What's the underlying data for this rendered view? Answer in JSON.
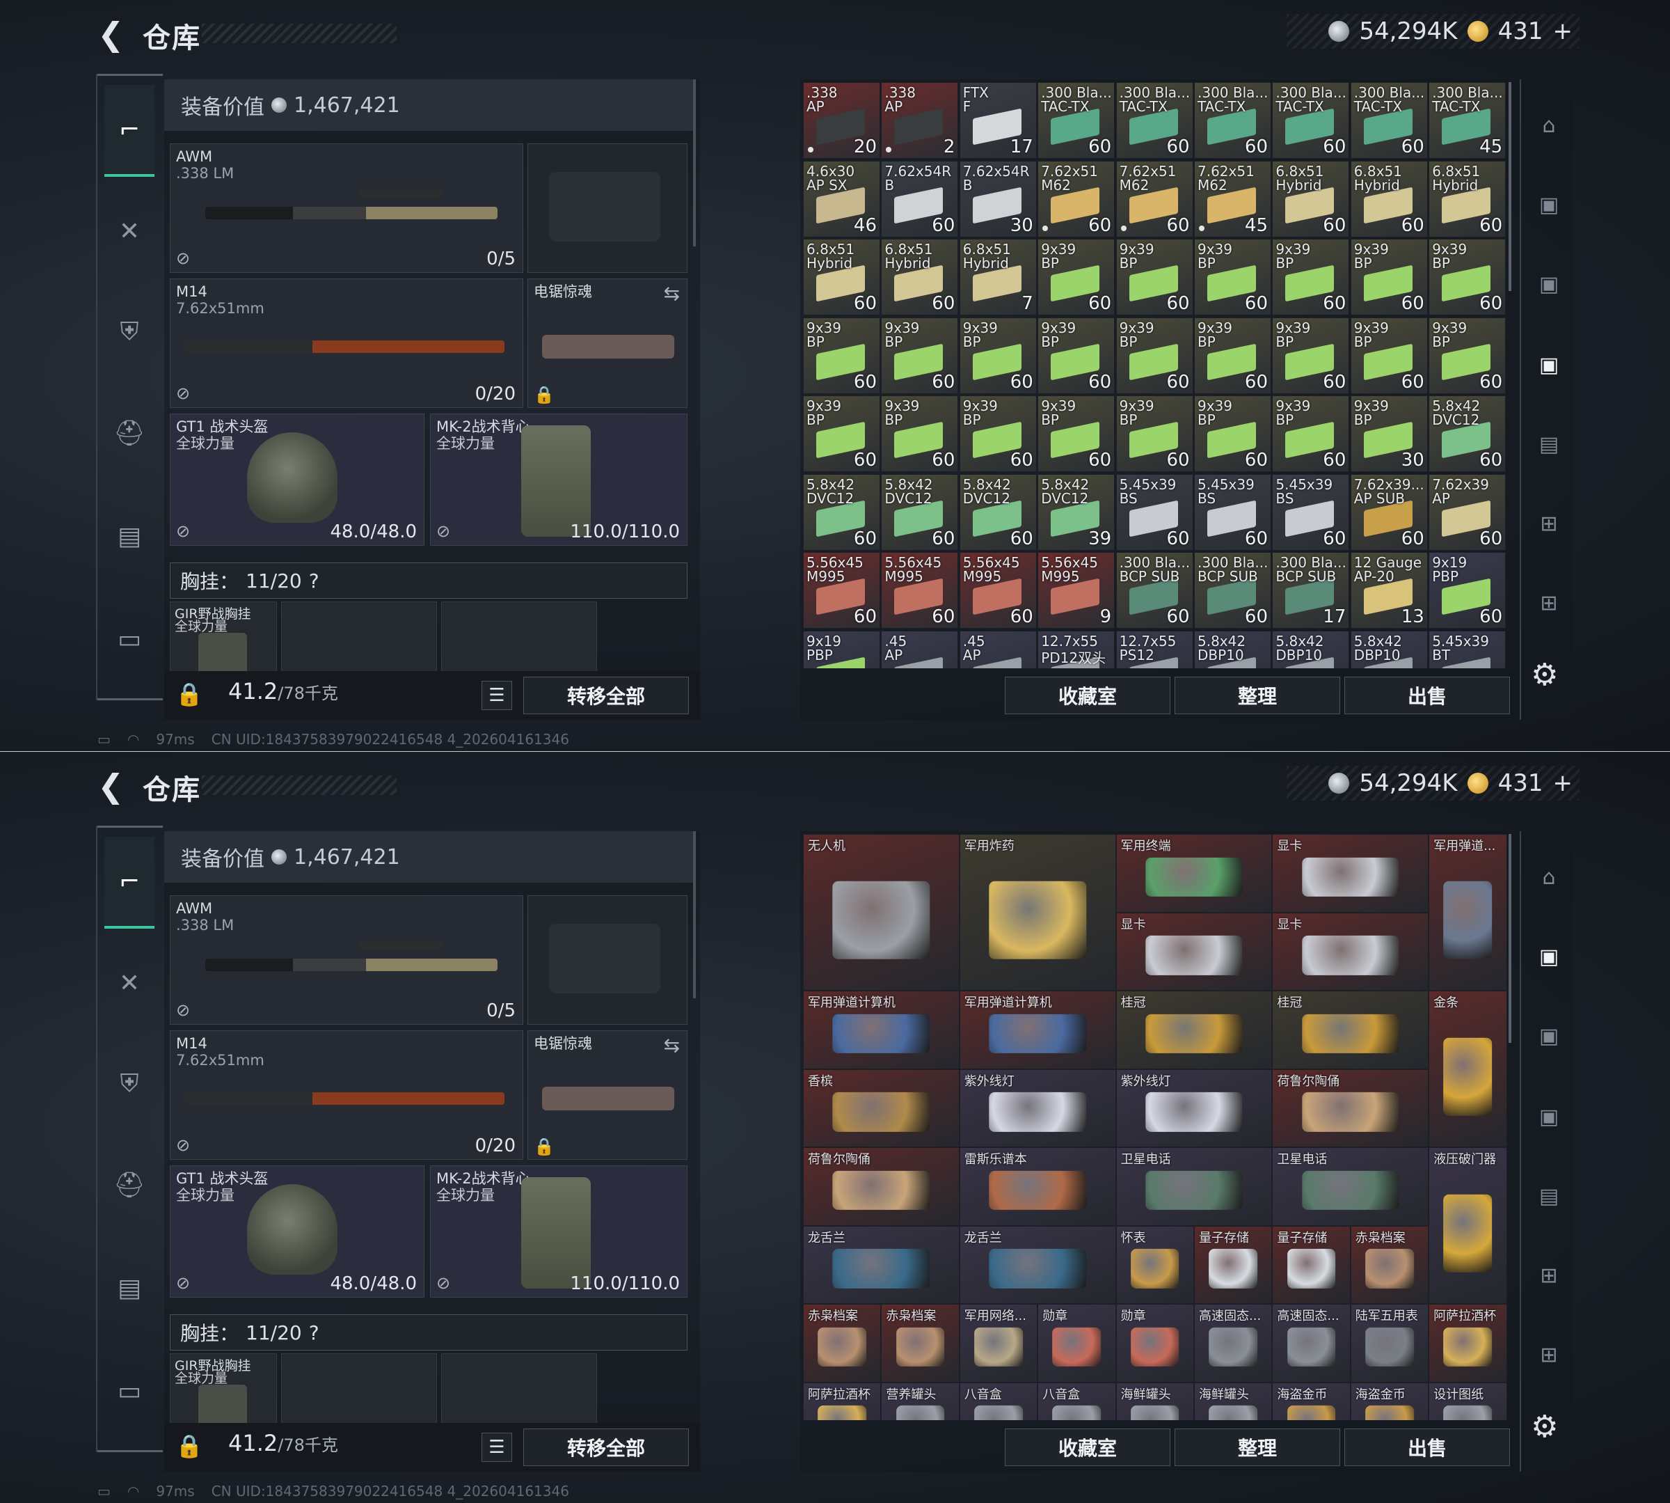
{
  "header": {
    "back_icon": "back-arrow-icon",
    "title": "仓库",
    "silver_amount": "54,294K",
    "gold_amount": "431",
    "gold_plus": "+"
  },
  "equipment": {
    "value_label": "装备价值",
    "value": "1,467,421",
    "primary": {
      "name": "AWM",
      "caliber": ".338 LM",
      "ammo": "0/5"
    },
    "secondary": {
      "name": "M14",
      "caliber": "7.62x51mm",
      "ammo": "0/20"
    },
    "melee": {
      "name": "电锯惊魂"
    },
    "helmet": {
      "name": "GT1 战术头盔",
      "sub": "全球力量",
      "durability": "48.0/48.0"
    },
    "armor": {
      "name": "MK-2战术背心",
      "sub": "全球力量",
      "durability": "110.0/110.0"
    },
    "chest_rig": {
      "label": "胸挂：",
      "capacity": "11/20",
      "help": "?",
      "item_name": "GIR野战胸挂",
      "item_sub": "全球力量"
    },
    "weight": "41.2",
    "weight_max": "/78千克",
    "transfer_all": "转移全部"
  },
  "stash_buttons": {
    "collection": "收藏室",
    "organize": "整理",
    "sell": "出售"
  },
  "status": {
    "ping": "97ms",
    "uid": "CN UID:18437583979022416548 4_202604161346"
  },
  "ammo_grid": [
    {
      "l1": ".338",
      "l2": "AP",
      "count": "20",
      "color": "#6a2c2c",
      "box": "#3a3d40",
      "dot": true
    },
    {
      "l1": ".338",
      "l2": "AP",
      "count": "2",
      "color": "#6a2c2c",
      "box": "#3a3d40",
      "dot": true
    },
    {
      "l1": "FTX",
      "l2": "F",
      "count": "17",
      "color": "#3a3d46",
      "box": "#d6d8dc",
      "dot": false
    },
    {
      "l1": ".300 Bla...",
      "l2": "TAC-TX",
      "count": "60",
      "color": "#4a4a38",
      "box": "#5aa88a",
      "dot": false
    },
    {
      "l1": ".300 Bla...",
      "l2": "TAC-TX",
      "count": "60",
      "color": "#4a4a38",
      "box": "#5aa88a",
      "dot": false
    },
    {
      "l1": ".300 Bla...",
      "l2": "TAC-TX",
      "count": "60",
      "color": "#4a4a38",
      "box": "#5aa88a",
      "dot": false
    },
    {
      "l1": ".300 Bla...",
      "l2": "TAC-TX",
      "count": "60",
      "color": "#4a4a38",
      "box": "#5aa88a",
      "dot": false
    },
    {
      "l1": ".300 Bla...",
      "l2": "TAC-TX",
      "count": "60",
      "color": "#4a4a38",
      "box": "#5aa88a",
      "dot": false
    },
    {
      "l1": ".300 Bla...",
      "l2": "TAC-TX",
      "count": "45",
      "color": "#4a4a38",
      "box": "#5aa88a",
      "dot": false
    },
    {
      "l1": "4.6x30",
      "l2": "AP SX",
      "count": "46",
      "color": "#4a4a38",
      "box": "#c8b890",
      "dot": false
    },
    {
      "l1": "7.62x54R",
      "l2": "B",
      "count": "60",
      "color": "#3a3d46",
      "box": "#d0d2d6",
      "dot": false
    },
    {
      "l1": "7.62x54R",
      "l2": "B",
      "count": "30",
      "color": "#3a3d46",
      "box": "#d0d2d6",
      "dot": false
    },
    {
      "l1": "7.62x51",
      "l2": "M62",
      "count": "60",
      "color": "#4a4a38",
      "box": "#d9b56a",
      "dot": true
    },
    {
      "l1": "7.62x51",
      "l2": "M62",
      "count": "60",
      "color": "#4a4a38",
      "box": "#d9b56a",
      "dot": true
    },
    {
      "l1": "7.62x51",
      "l2": "M62",
      "count": "45",
      "color": "#4a4a38",
      "box": "#d9b56a",
      "dot": true
    },
    {
      "l1": "6.8x51",
      "l2": "Hybrid",
      "count": "60",
      "color": "#4a4a38",
      "box": "#d4c796",
      "dot": false
    },
    {
      "l1": "6.8x51",
      "l2": "Hybrid",
      "count": "60",
      "color": "#4a4a38",
      "box": "#d4c796",
      "dot": false
    },
    {
      "l1": "6.8x51",
      "l2": "Hybrid",
      "count": "60",
      "color": "#4a4a38",
      "box": "#d4c796",
      "dot": false
    },
    {
      "l1": "6.8x51",
      "l2": "Hybrid",
      "count": "60",
      "color": "#4a4a38",
      "box": "#d4c796",
      "dot": false
    },
    {
      "l1": "6.8x51",
      "l2": "Hybrid",
      "count": "60",
      "color": "#4a4a38",
      "box": "#d4c796",
      "dot": false
    },
    {
      "l1": "6.8x51",
      "l2": "Hybrid",
      "count": "7",
      "color": "#4a4a38",
      "box": "#d4c796",
      "dot": false
    },
    {
      "l1": "9x39",
      "l2": "BP",
      "count": "60",
      "color": "#4a4a38",
      "box": "#9bd46a",
      "dot": false
    },
    {
      "l1": "9x39",
      "l2": "BP",
      "count": "60",
      "color": "#4a4a38",
      "box": "#9bd46a",
      "dot": false
    },
    {
      "l1": "9x39",
      "l2": "BP",
      "count": "60",
      "color": "#4a4a38",
      "box": "#9bd46a",
      "dot": false
    },
    {
      "l1": "9x39",
      "l2": "BP",
      "count": "60",
      "color": "#4a4a38",
      "box": "#9bd46a",
      "dot": false
    },
    {
      "l1": "9x39",
      "l2": "BP",
      "count": "60",
      "color": "#4a4a38",
      "box": "#9bd46a",
      "dot": false
    },
    {
      "l1": "9x39",
      "l2": "BP",
      "count": "60",
      "color": "#4a4a38",
      "box": "#9bd46a",
      "dot": false
    },
    {
      "l1": "9x39",
      "l2": "BP",
      "count": "60",
      "color": "#4a4a38",
      "box": "#9bd46a",
      "dot": false
    },
    {
      "l1": "9x39",
      "l2": "BP",
      "count": "60",
      "color": "#4a4a38",
      "box": "#9bd46a",
      "dot": false
    },
    {
      "l1": "9x39",
      "l2": "BP",
      "count": "60",
      "color": "#4a4a38",
      "box": "#9bd46a",
      "dot": false
    },
    {
      "l1": "9x39",
      "l2": "BP",
      "count": "60",
      "color": "#4a4a38",
      "box": "#9bd46a",
      "dot": false
    },
    {
      "l1": "9x39",
      "l2": "BP",
      "count": "60",
      "color": "#4a4a38",
      "box": "#9bd46a",
      "dot": false
    },
    {
      "l1": "9x39",
      "l2": "BP",
      "count": "60",
      "color": "#4a4a38",
      "box": "#9bd46a",
      "dot": false
    },
    {
      "l1": "9x39",
      "l2": "BP",
      "count": "60",
      "color": "#4a4a38",
      "box": "#9bd46a",
      "dot": false
    },
    {
      "l1": "9x39",
      "l2": "BP",
      "count": "60",
      "color": "#4a4a38",
      "box": "#9bd46a",
      "dot": false
    },
    {
      "l1": "9x39",
      "l2": "BP",
      "count": "60",
      "color": "#4a4a38",
      "box": "#9bd46a",
      "dot": false
    },
    {
      "l1": "9x39",
      "l2": "BP",
      "count": "60",
      "color": "#4a4a38",
      "box": "#9bd46a",
      "dot": false
    },
    {
      "l1": "9x39",
      "l2": "BP",
      "count": "60",
      "color": "#4a4a38",
      "box": "#9bd46a",
      "dot": false
    },
    {
      "l1": "9x39",
      "l2": "BP",
      "count": "60",
      "color": "#4a4a38",
      "box": "#9bd46a",
      "dot": false
    },
    {
      "l1": "9x39",
      "l2": "BP",
      "count": "60",
      "color": "#4a4a38",
      "box": "#9bd46a",
      "dot": false
    },
    {
      "l1": "9x39",
      "l2": "BP",
      "count": "60",
      "color": "#4a4a38",
      "box": "#9bd46a",
      "dot": false
    },
    {
      "l1": "9x39",
      "l2": "BP",
      "count": "60",
      "color": "#4a4a38",
      "box": "#9bd46a",
      "dot": false
    },
    {
      "l1": "9x39",
      "l2": "BP",
      "count": "60",
      "color": "#4a4a38",
      "box": "#9bd46a",
      "dot": false
    },
    {
      "l1": "9x39",
      "l2": "BP",
      "count": "30",
      "color": "#4a4a38",
      "box": "#9bd46a",
      "dot": false
    },
    {
      "l1": "5.8x42",
      "l2": "DVC12",
      "count": "60",
      "color": "#4a4a38",
      "box": "#7cc08a",
      "dot": false
    },
    {
      "l1": "5.8x42",
      "l2": "DVC12",
      "count": "60",
      "color": "#4a4a38",
      "box": "#7cc08a",
      "dot": false
    },
    {
      "l1": "5.8x42",
      "l2": "DVC12",
      "count": "60",
      "color": "#4a4a38",
      "box": "#7cc08a",
      "dot": false
    },
    {
      "l1": "5.8x42",
      "l2": "DVC12",
      "count": "60",
      "color": "#4a4a38",
      "box": "#7cc08a",
      "dot": false
    },
    {
      "l1": "5.8x42",
      "l2": "DVC12",
      "count": "39",
      "color": "#4a4a38",
      "box": "#7cc08a",
      "dot": false
    },
    {
      "l1": "5.45x39",
      "l2": "BS",
      "count": "60",
      "color": "#3a3d46",
      "box": "#c8ccd2",
      "dot": false
    },
    {
      "l1": "5.45x39",
      "l2": "BS",
      "count": "60",
      "color": "#3a3d46",
      "box": "#c8ccd2",
      "dot": false
    },
    {
      "l1": "5.45x39",
      "l2": "BS",
      "count": "60",
      "color": "#3a3d46",
      "box": "#c8ccd2",
      "dot": false
    },
    {
      "l1": "7.62x39...",
      "l2": "AP SUB",
      "count": "60",
      "color": "#4a4a38",
      "box": "#c9a04a",
      "dot": false
    },
    {
      "l1": "7.62x39",
      "l2": "AP",
      "count": "60",
      "color": "#4a4a38",
      "box": "#d4c796",
      "dot": false
    },
    {
      "l1": "5.56x45",
      "l2": "M995",
      "count": "60",
      "color": "#6a2c2c",
      "box": "#c07060",
      "dot": false
    },
    {
      "l1": "5.56x45",
      "l2": "M995",
      "count": "60",
      "color": "#6a2c2c",
      "box": "#c07060",
      "dot": false
    },
    {
      "l1": "5.56x45",
      "l2": "M995",
      "count": "60",
      "color": "#6a2c2c",
      "box": "#c07060",
      "dot": false
    },
    {
      "l1": "5.56x45",
      "l2": "M995",
      "count": "9",
      "color": "#6a2c2c",
      "box": "#c07060",
      "dot": false
    },
    {
      "l1": ".300 Bla...",
      "l2": "BCP SUB",
      "count": "60",
      "color": "#4a4a38",
      "box": "#5a8a78",
      "dot": false
    },
    {
      "l1": ".300 Bla...",
      "l2": "BCP SUB",
      "count": "60",
      "color": "#4a4a38",
      "box": "#5a8a78",
      "dot": false
    },
    {
      "l1": ".300 Bla...",
      "l2": "BCP SUB",
      "count": "17",
      "color": "#4a4a38",
      "box": "#5a8a78",
      "dot": false
    },
    {
      "l1": "12 Gauge",
      "l2": "AP-20",
      "count": "13",
      "color": "#4a4a38",
      "box": "#d9c27a",
      "dot": false
    },
    {
      "l1": "9x19",
      "l2": "PBP",
      "count": "60",
      "color": "#3a3a4e",
      "box": "#9bd46a",
      "dot": false
    },
    {
      "l1": "9x19",
      "l2": "PBP",
      "count": "",
      "color": "#3a3a4e",
      "box": "#9bd46a",
      "dot": false
    },
    {
      "l1": ".45",
      "l2": "AP",
      "count": "",
      "color": "#3a3a4e",
      "box": "#9aa0a8",
      "dot": false
    },
    {
      "l1": ".45",
      "l2": "AP",
      "count": "",
      "color": "#3a3a4e",
      "box": "#9aa0a8",
      "dot": false
    },
    {
      "l1": "12.7x55",
      "l2": "PD12双头",
      "count": "",
      "color": "#3a3a4e",
      "box": "#9aa0a8",
      "dot": false
    },
    {
      "l1": "12.7x55",
      "l2": "PS12",
      "count": "",
      "color": "#3a3a4e",
      "box": "#9aa0a8",
      "dot": false
    },
    {
      "l1": "5.8x42",
      "l2": "DBP10",
      "count": "",
      "color": "#3a3a4e",
      "box": "#9aa0a8",
      "dot": false
    },
    {
      "l1": "5.8x42",
      "l2": "DBP10",
      "count": "",
      "color": "#3a3a4e",
      "box": "#9aa0a8",
      "dot": false
    },
    {
      "l1": "5.8x42",
      "l2": "DBP10",
      "count": "",
      "color": "#3a3a4e",
      "box": "#9aa0a8",
      "dot": false
    },
    {
      "l1": "5.45x39",
      "l2": "BT",
      "count": "",
      "color": "#3a3a4e",
      "box": "#9aa0a8",
      "dot": false
    }
  ],
  "valuables": [
    {
      "name": "无人机",
      "col": 0,
      "row": 0,
      "w": 2,
      "h": 2,
      "color": "#5a2a2a",
      "art": "#9aa0a6",
      "icon": "drone-icon"
    },
    {
      "name": "军用炸药",
      "col": 2,
      "row": 0,
      "w": 2,
      "h": 2,
      "color": "#3e3a2e",
      "art": "#d9b860",
      "icon": "explosive-crate-icon"
    },
    {
      "name": "军用终端",
      "col": 4,
      "row": 0,
      "w": 2,
      "h": 1,
      "color": "#5a2a2a",
      "art": "#5aa06a",
      "icon": "military-terminal-icon"
    },
    {
      "name": "显卡",
      "col": 6,
      "row": 0,
      "w": 2,
      "h": 1,
      "color": "#5a2a2a",
      "art": "#c8ccd2",
      "icon": "graphics-card-icon"
    },
    {
      "name": "显卡",
      "col": 4,
      "row": 1,
      "w": 2,
      "h": 1,
      "color": "#5a2a2a",
      "art": "#c8ccd2",
      "icon": "graphics-card-icon"
    },
    {
      "name": "显卡",
      "col": 6,
      "row": 1,
      "w": 2,
      "h": 1,
      "color": "#5a2a2a",
      "art": "#c8ccd2",
      "icon": "graphics-card-icon"
    },
    {
      "name": "军用弹道...",
      "col": 8,
      "row": 0,
      "w": 1,
      "h": 2,
      "color": "#5a2a2a",
      "art": "#6a7890",
      "icon": "ballistic-device-icon"
    },
    {
      "name": "军用弹道计算机",
      "col": 0,
      "row": 2,
      "w": 2,
      "h": 1,
      "color": "#5a2a2a",
      "art": "#4a6aa0",
      "icon": "ballistic-computer-icon"
    },
    {
      "name": "军用弹道计算机",
      "col": 2,
      "row": 2,
      "w": 2,
      "h": 1,
      "color": "#5a2a2a",
      "art": "#4a6aa0",
      "icon": "ballistic-computer-icon"
    },
    {
      "name": "桂冠",
      "col": 4,
      "row": 2,
      "w": 2,
      "h": 1,
      "color": "#3e3a2e",
      "art": "#c99a3a",
      "icon": "laurel-crown-icon"
    },
    {
      "name": "桂冠",
      "col": 6,
      "row": 2,
      "w": 2,
      "h": 1,
      "color": "#3e3a2e",
      "art": "#c99a3a",
      "icon": "laurel-crown-icon"
    },
    {
      "name": "金条",
      "col": 8,
      "row": 2,
      "w": 1,
      "h": 2,
      "color": "#5a2a2a",
      "art": "#d6a63a",
      "icon": "gold-bar-icon"
    },
    {
      "name": "香槟",
      "col": 0,
      "row": 3,
      "w": 2,
      "h": 1,
      "color": "#5a2a2a",
      "art": "#b08a4a",
      "icon": "champagne-icon"
    },
    {
      "name": "紫外线灯",
      "col": 2,
      "row": 3,
      "w": 2,
      "h": 1,
      "color": "#3a3448",
      "art": "#d6d8e4",
      "icon": "uv-lamp-icon"
    },
    {
      "name": "紫外线灯",
      "col": 4,
      "row": 3,
      "w": 2,
      "h": 1,
      "color": "#3a3448",
      "art": "#d6d8e4",
      "icon": "uv-lamp-icon"
    },
    {
      "name": "荷鲁尔陶俑",
      "col": 6,
      "row": 3,
      "w": 2,
      "h": 1,
      "color": "#5a2a2a",
      "art": "#c8a478",
      "icon": "figurine-icon"
    },
    {
      "name": "荷鲁尔陶俑",
      "col": 0,
      "row": 4,
      "w": 2,
      "h": 1,
      "color": "#5a2a2a",
      "art": "#c8a478",
      "icon": "figurine-icon"
    },
    {
      "name": "雷斯乐谱本",
      "col": 2,
      "row": 4,
      "w": 2,
      "h": 1,
      "color": "#3a3448",
      "art": "#b06a48",
      "icon": "music-book-icon"
    },
    {
      "name": "卫星电话",
      "col": 4,
      "row": 4,
      "w": 2,
      "h": 1,
      "color": "#3a3448",
      "art": "#5a7a6a",
      "icon": "satellite-phone-icon"
    },
    {
      "name": "卫星电话",
      "col": 6,
      "row": 4,
      "w": 2,
      "h": 1,
      "color": "#3a3448",
      "art": "#5a7a6a",
      "icon": "satellite-phone-icon"
    },
    {
      "name": "液压破门器",
      "col": 8,
      "row": 4,
      "w": 1,
      "h": 2,
      "color": "#3a3448",
      "art": "#d6a83a",
      "icon": "hydraulic-breacher-icon"
    },
    {
      "name": "龙舌兰",
      "col": 0,
      "row": 5,
      "w": 2,
      "h": 1,
      "color": "#3a3448",
      "art": "#3a6a8a",
      "icon": "tequila-icon"
    },
    {
      "name": "龙舌兰",
      "col": 2,
      "row": 5,
      "w": 2,
      "h": 1,
      "color": "#3a3448",
      "art": "#3a6a8a",
      "icon": "tequila-icon"
    },
    {
      "name": "怀表",
      "col": 4,
      "row": 5,
      "w": 1,
      "h": 1,
      "color": "#3a3448",
      "art": "#c89a4a",
      "icon": "pocket-watch-icon"
    },
    {
      "name": "量子存储",
      "col": 5,
      "row": 5,
      "w": 1,
      "h": 1,
      "color": "#5a2a2a",
      "art": "#d8dce2",
      "icon": "quantum-storage-icon"
    },
    {
      "name": "量子存储",
      "col": 6,
      "row": 5,
      "w": 1,
      "h": 1,
      "color": "#5a2a2a",
      "art": "#d8dce2",
      "icon": "quantum-storage-icon"
    },
    {
      "name": "赤枭档案",
      "col": 7,
      "row": 5,
      "w": 1,
      "h": 1,
      "color": "#5a2a2a",
      "art": "#b89070",
      "icon": "archive-icon"
    },
    {
      "name": "赤枭档案",
      "col": 0,
      "row": 6,
      "w": 1,
      "h": 1,
      "color": "#5a2a2a",
      "art": "#b89070",
      "icon": "archive-icon"
    },
    {
      "name": "赤枭档案",
      "col": 1,
      "row": 6,
      "w": 1,
      "h": 1,
      "color": "#5a2a2a",
      "art": "#b89070",
      "icon": "archive-icon"
    },
    {
      "name": "军用网络...",
      "col": 2,
      "row": 6,
      "w": 1,
      "h": 1,
      "color": "#3a3448",
      "art": "#b8a888",
      "icon": "network-device-icon"
    },
    {
      "name": "勋章",
      "col": 3,
      "row": 6,
      "w": 1,
      "h": 1,
      "color": "#3a3448",
      "art": "#c86a5a",
      "icon": "medal-icon"
    },
    {
      "name": "勋章",
      "col": 4,
      "row": 6,
      "w": 1,
      "h": 1,
      "color": "#3a3448",
      "art": "#c86a5a",
      "icon": "medal-icon"
    },
    {
      "name": "高速固态...",
      "col": 5,
      "row": 6,
      "w": 1,
      "h": 1,
      "color": "#3a3448",
      "art": "#8a9098",
      "icon": "ssd-icon"
    },
    {
      "name": "高速固态...",
      "col": 6,
      "row": 6,
      "w": 1,
      "h": 1,
      "color": "#3a3448",
      "art": "#8a9098",
      "icon": "ssd-icon"
    },
    {
      "name": "陆军五用表",
      "col": 7,
      "row": 6,
      "w": 1,
      "h": 1,
      "color": "#3a3448",
      "art": "#7a8088",
      "icon": "multimeter-icon"
    },
    {
      "name": "阿萨拉酒杯",
      "col": 8,
      "row": 6,
      "w": 1,
      "h": 1,
      "color": "#5a2a2a",
      "art": "#d6b058",
      "icon": "goblet-icon"
    },
    {
      "name": "阿萨拉酒杯",
      "col": 0,
      "row": 7,
      "w": 1,
      "h": 1,
      "color": "#3a3448",
      "art": "#d6b058",
      "icon": "goblet-icon"
    },
    {
      "name": "营养罐头",
      "col": 1,
      "row": 7,
      "w": 1,
      "h": 1,
      "color": "#3a3448",
      "art": "#9aa0a8",
      "icon": "canned-food-icon"
    },
    {
      "name": "八音盒",
      "col": 2,
      "row": 7,
      "w": 1,
      "h": 1,
      "color": "#3a3448",
      "art": "#9aa0a8",
      "icon": "music-box-icon"
    },
    {
      "name": "八音盒",
      "col": 3,
      "row": 7,
      "w": 1,
      "h": 1,
      "color": "#3a3448",
      "art": "#9aa0a8",
      "icon": "music-box-icon"
    },
    {
      "name": "海鲜罐头",
      "col": 4,
      "row": 7,
      "w": 1,
      "h": 1,
      "color": "#3a3448",
      "art": "#9aa0a8",
      "icon": "canned-seafood-icon"
    },
    {
      "name": "海鲜罐头",
      "col": 5,
      "row": 7,
      "w": 1,
      "h": 1,
      "color": "#3a3448",
      "art": "#9aa0a8",
      "icon": "canned-seafood-icon"
    },
    {
      "name": "海盗金币",
      "col": 6,
      "row": 7,
      "w": 1,
      "h": 1,
      "color": "#3a3448",
      "art": "#c89a4a",
      "icon": "pirate-coin-icon"
    },
    {
      "name": "海盗金币",
      "col": 7,
      "row": 7,
      "w": 1,
      "h": 1,
      "color": "#3a3448",
      "art": "#c89a4a",
      "icon": "pirate-coin-icon"
    },
    {
      "name": "设计图纸",
      "col": 8,
      "row": 7,
      "w": 1,
      "h": 1,
      "color": "#3a3448",
      "art": "#9aa0a8",
      "icon": "blueprint-icon"
    }
  ],
  "icons": {
    "nav": [
      "pistol-icon",
      "backpack-icon",
      "vest-icon",
      "helmet-icon",
      "case-icon",
      "briefcase-icon"
    ],
    "rightnav": [
      "helmet-tab-icon",
      "safe-v-icon",
      "safe-iv-icon",
      "safe-active-icon",
      "safe-iii-icon",
      "safe-ii-icon",
      "safe-i-icon"
    ]
  }
}
